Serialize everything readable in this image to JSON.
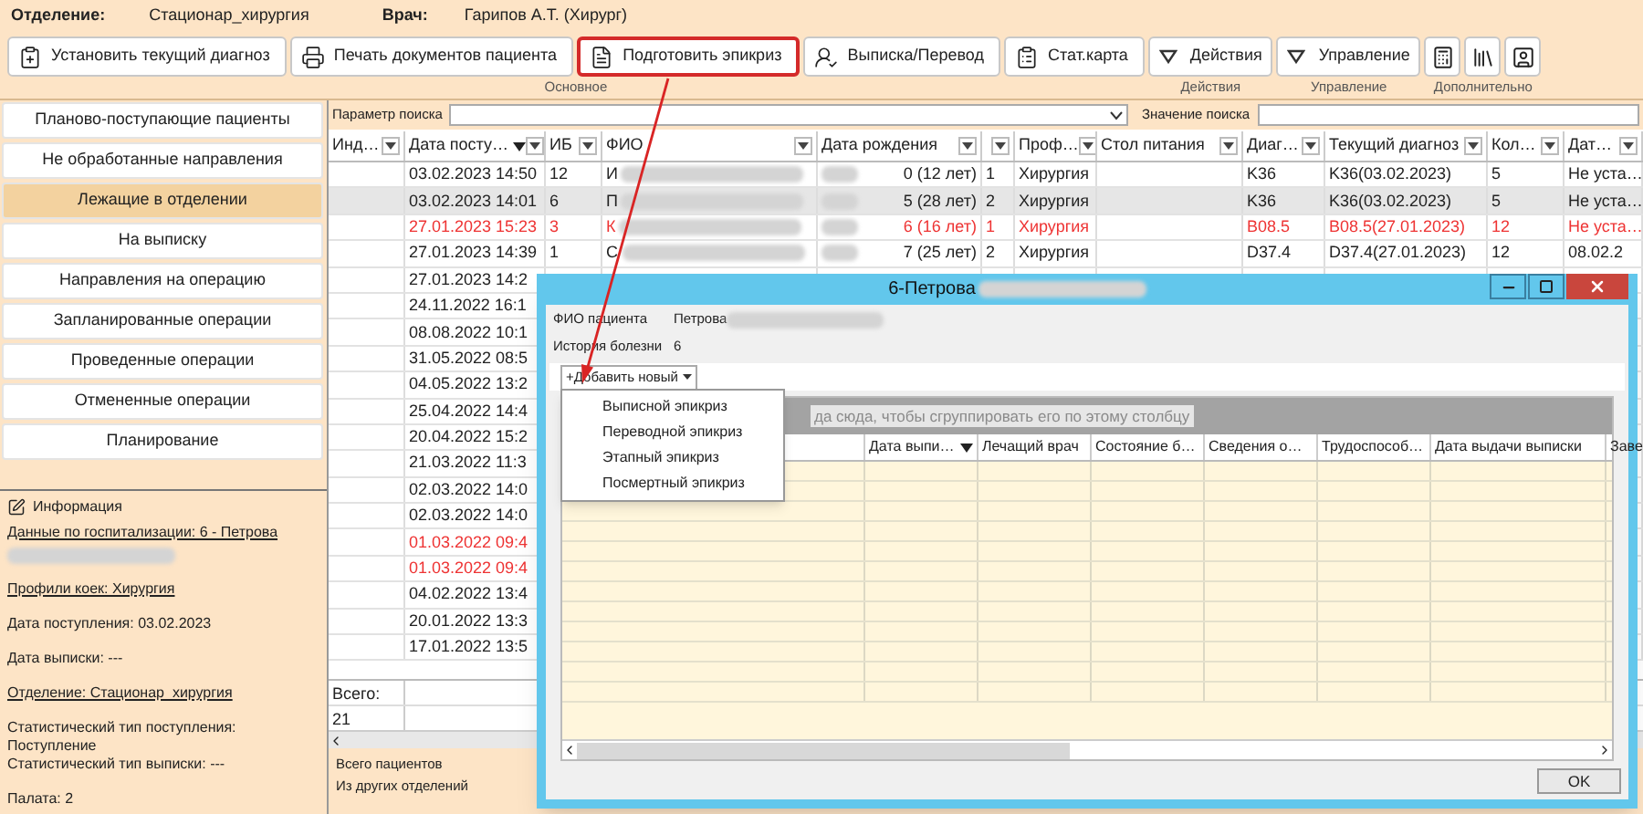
{
  "header": {
    "department_label": "Отделение:",
    "department": "Стационар_хирургия",
    "doctor_label": "Врач:",
    "doctor": "Гарипов А.Т. (Хирург)"
  },
  "toolbar_groups": [
    {
      "label": "Основное",
      "buttons": [
        {
          "kind": "text",
          "label": "Установить текущий диагноз",
          "highlighted": false
        },
        {
          "kind": "text",
          "label": "Печать документов пациента",
          "highlighted": false
        },
        {
          "kind": "text",
          "label": "Подготовить эпикриз",
          "highlighted": true
        },
        {
          "kind": "text",
          "label": "Выписка/Перевод",
          "highlighted": false
        },
        {
          "kind": "text",
          "label": "Стат.карта",
          "highlighted": false
        }
      ]
    },
    {
      "label": "Действия",
      "buttons": [
        {
          "kind": "dropdown",
          "label": "Действия",
          "highlighted": false
        }
      ]
    },
    {
      "label": "Управление",
      "buttons": [
        {
          "kind": "dropdown",
          "label": "Управление",
          "highlighted": false
        }
      ]
    },
    {
      "label": "Дополнительно",
      "buttons": [
        {
          "kind": "icon",
          "highlighted": false
        },
        {
          "kind": "icon",
          "highlighted": false
        },
        {
          "kind": "icon",
          "highlighted": false
        }
      ]
    }
  ],
  "nav": [
    {
      "label": "Планово-поступающие пациенты",
      "selected": false
    },
    {
      "label": "Не обработанные направления",
      "selected": false
    },
    {
      "label": "Лежащие в отделении",
      "selected": true
    },
    {
      "label": "На выписку",
      "selected": false
    },
    {
      "label": "Направления на операцию",
      "selected": false
    },
    {
      "label": "Запланированные операции",
      "selected": false
    },
    {
      "label": "Проведенные операции",
      "selected": false
    },
    {
      "label": "Отмененные операции",
      "selected": false
    },
    {
      "label": "Планирование",
      "selected": false
    }
  ],
  "info": {
    "title": "Информация",
    "blocks": [
      {
        "kind": "link",
        "lines": [
          "Данные по госпитализации: 6 - Петрова"
        ],
        "redacted": true
      },
      {
        "kind": "link",
        "lines": [
          "Профили коек: Хирургия"
        ]
      },
      {
        "kind": "text",
        "lines": [
          "Дата поступления: 03.02.2023"
        ]
      },
      {
        "kind": "text",
        "lines": [
          "Дата выписки: ---"
        ]
      },
      {
        "kind": "link",
        "lines": [
          "Отделение: Стационар_хирургия"
        ]
      },
      {
        "kind": "text",
        "lines": [
          "Статистический тип поступления:",
          "Поступление",
          "Статистический тип выписки: ---"
        ]
      },
      {
        "kind": "text",
        "lines": [
          "Палата: 2"
        ]
      }
    ]
  },
  "search": {
    "param_label": "Параметр поиска",
    "value_label": "Значение поиска"
  },
  "table": {
    "columns": [
      {
        "label": "Инд…"
      },
      {
        "label": "Дата посту…",
        "sorted": true
      },
      {
        "label": "ИБ"
      },
      {
        "label": "ФИО"
      },
      {
        "label": "Дата рождения"
      },
      {},
      {
        "label": "Проф…"
      },
      {
        "label": "Стол питания"
      },
      {
        "label": "Диаг…"
      },
      {
        "label": "Текущий диагноз"
      },
      {
        "label": "Кол…"
      },
      {
        "label": "Дат…"
      }
    ],
    "rows": [
      {
        "date": "03.02.2023 14:50",
        "ib": "12",
        "fio": "И",
        "birth": "0 (12 лет)",
        "column_6": "1",
        "profile": "Хирургия",
        "diagnosis": "K36",
        "current_diagnosis": "K36(03.02.2023)",
        "count": "5",
        "date_2": "Не уста…",
        "redacted": true,
        "selected": false,
        "alert": false
      },
      {
        "date": "03.02.2023 14:01",
        "ib": "6",
        "fio": "П",
        "birth": "5 (28 лет)",
        "column_6": "2",
        "profile": "Хирургия",
        "diagnosis": "K36",
        "current_diagnosis": "K36(03.02.2023)",
        "count": "5",
        "date_2": "Не уста…",
        "redacted": true,
        "selected": true,
        "alert": false
      },
      {
        "date": "27.01.2023 15:23",
        "ib": "3",
        "fio": "К",
        "birth": "6 (16 лет)",
        "column_6": "1",
        "profile": "Хирургия",
        "diagnosis": "B08.5",
        "current_diagnosis": "B08.5(27.01.2023)",
        "count": "12",
        "date_2": "Не уста…",
        "redacted": true,
        "selected": false,
        "alert": true
      },
      {
        "date": "27.01.2023 14:39",
        "ib": "1",
        "fio": "С",
        "birth": "7 (25 лет)",
        "column_6": "2",
        "profile": "Хирургия",
        "diagnosis": "D37.4",
        "current_diagnosis": "D37.4(27.01.2023)",
        "count": "12",
        "date_2": "08.02.2",
        "redacted": true,
        "selected": false,
        "alert": false
      },
      {
        "date": "27.01.2023 14:2",
        "selected": false,
        "alert": false
      },
      {
        "date": "24.11.2022 16:1",
        "selected": false,
        "alert": false
      },
      {
        "date": "08.08.2022 10:1",
        "selected": false,
        "alert": false
      },
      {
        "date": "31.05.2022 08:5",
        "selected": false,
        "alert": false
      },
      {
        "date": "04.05.2022 13:2",
        "selected": false,
        "alert": false
      },
      {
        "date": "25.04.2022 14:4",
        "selected": false,
        "alert": false
      },
      {
        "date": "20.04.2022 15:2",
        "selected": false,
        "alert": false
      },
      {
        "date": "21.03.2022 11:3",
        "selected": false,
        "alert": false
      },
      {
        "date": "02.03.2022 14:0",
        "selected": false,
        "alert": false
      },
      {
        "date": "02.03.2022 14:0",
        "selected": false,
        "alert": false
      },
      {
        "date": "01.03.2022 09:4",
        "selected": false,
        "alert": true
      },
      {
        "date": "01.03.2022 09:4",
        "selected": false,
        "alert": true
      },
      {
        "date": "04.02.2022 13:4",
        "selected": false,
        "alert": false
      },
      {
        "date": "20.01.2022 13:3",
        "selected": false,
        "alert": false
      },
      {
        "date": "17.01.2022 13:5",
        "selected": false,
        "alert": false
      }
    ],
    "total_label": "Всего:",
    "total": "21"
  },
  "summary": [
    "Всего пациентов",
    "Из других отделений"
  ],
  "dialog": {
    "title": "6-Петрова",
    "fields": [
      {
        "label": "ФИО пациента",
        "value": "Петрова",
        "redacted": true
      },
      {
        "label": "История болезни",
        "value": "6"
      }
    ],
    "add_button": "+Добавить новый",
    "menu": [
      "Выписной эпикриз",
      "Переводной эпикриз",
      "Этапный эпикриз",
      "Посмертный эпикриз"
    ],
    "group_hint": "да сюда, чтобы сгруппировать его по этому столбцу",
    "columns": [
      {},
      {
        "label": "Дата выпи…",
        "sorted": true
      },
      {
        "label": "Лечащий врач"
      },
      {
        "label": "Состояние б…"
      },
      {
        "label": "Сведения о…"
      },
      {
        "label": "Трудоспособ…"
      },
      {
        "label": "Дата выдачи выписки"
      },
      {
        "label": "Заве"
      }
    ],
    "ok": "OK"
  }
}
